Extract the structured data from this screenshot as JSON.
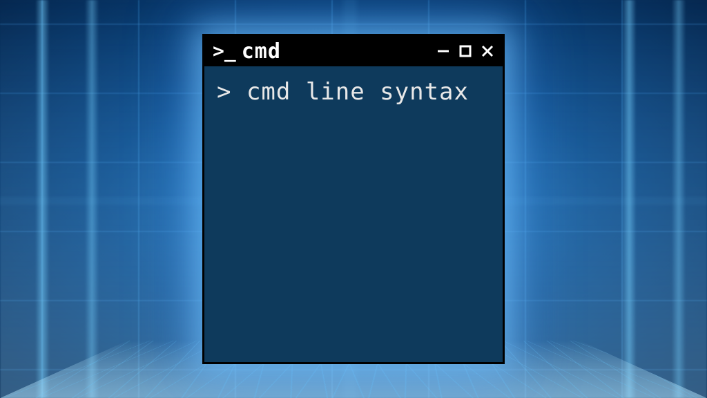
{
  "window": {
    "title": "cmd",
    "prompt_icon": ">_"
  },
  "terminal": {
    "prompt": "> ",
    "command": "cmd line syntax"
  },
  "colors": {
    "titlebar_bg": "#000000",
    "terminal_bg": "#0e3a5c",
    "text": "#e8e8e8",
    "glow": "#78c8ff"
  }
}
